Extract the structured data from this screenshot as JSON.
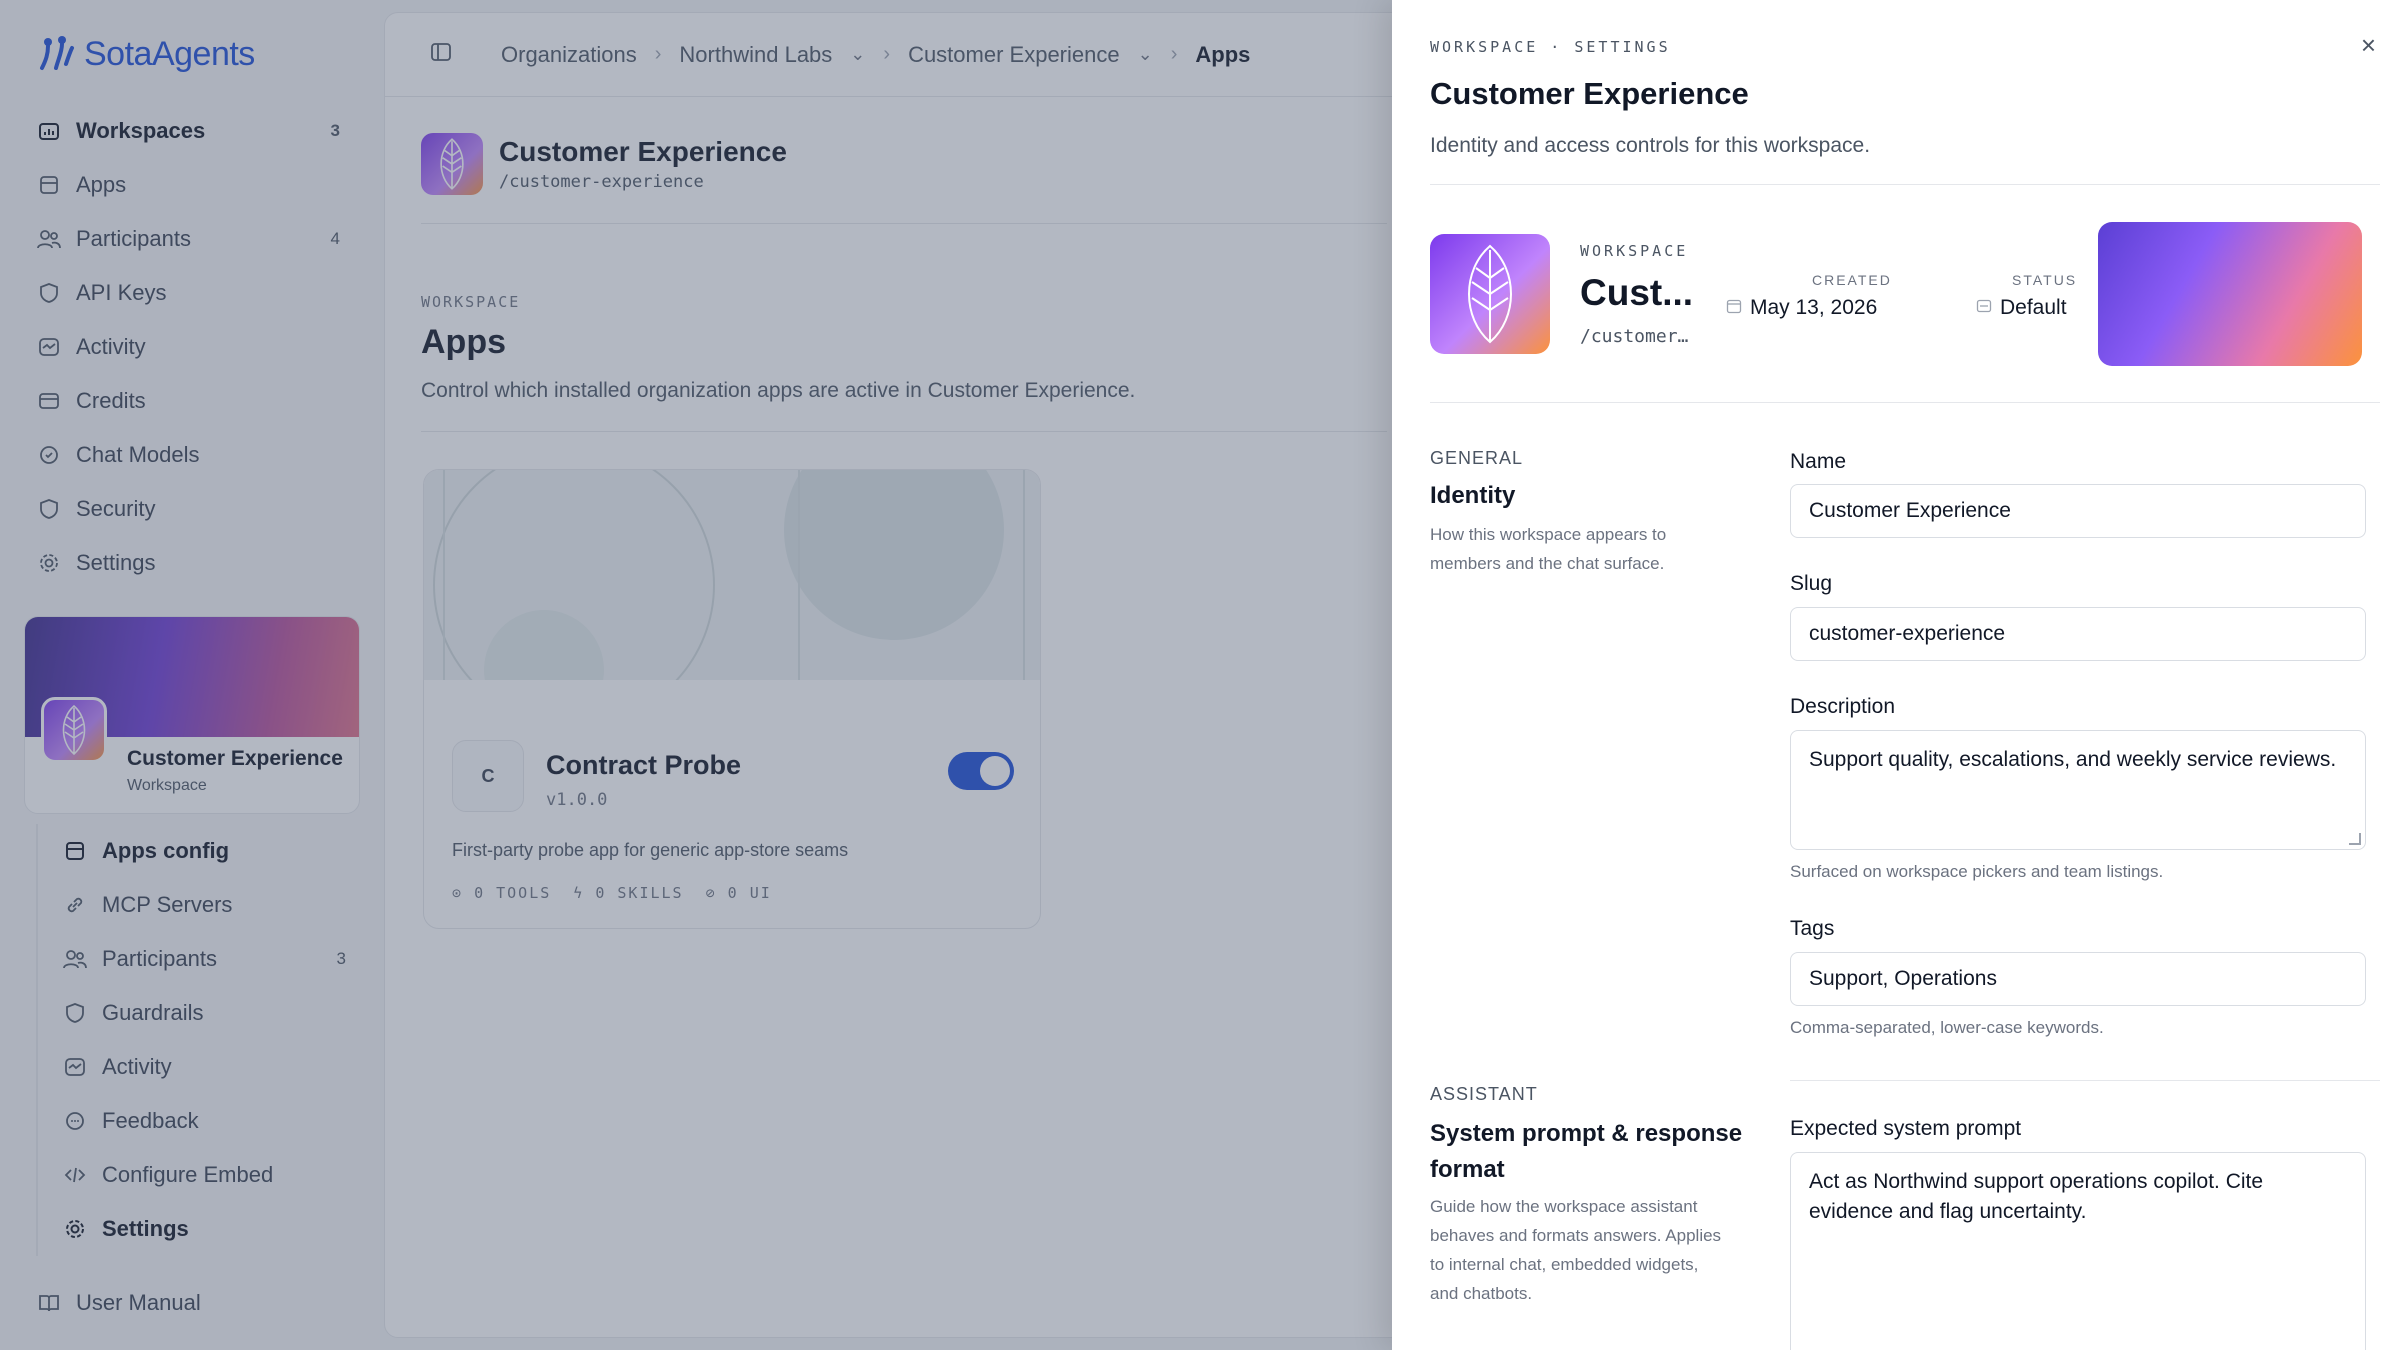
{
  "brand": {
    "name": "SotaAgents",
    "color": "#1d4ed8"
  },
  "sidebar": {
    "items": [
      {
        "label": "Workspaces",
        "count": "3",
        "icon": "workspaces-icon",
        "active": true
      },
      {
        "label": "Apps",
        "count": "",
        "icon": "apps-icon"
      },
      {
        "label": "Participants",
        "count": "4",
        "icon": "participants-icon"
      },
      {
        "label": "API Keys",
        "count": "",
        "icon": "shield-icon"
      },
      {
        "label": "Activity",
        "count": "",
        "icon": "activity-icon"
      },
      {
        "label": "Credits",
        "count": "",
        "icon": "credits-icon"
      },
      {
        "label": "Chat Models",
        "count": "",
        "icon": "chat-models-icon"
      },
      {
        "label": "Security",
        "count": "",
        "icon": "shield-icon"
      },
      {
        "label": "Settings",
        "count": "",
        "icon": "gear-icon"
      }
    ],
    "workspace_card": {
      "name": "Customer Experience",
      "type": "Workspace"
    },
    "subitems": [
      {
        "label": "Apps config",
        "count": "",
        "icon": "apps-icon",
        "active": true
      },
      {
        "label": "MCP Servers",
        "count": "",
        "icon": "link-icon"
      },
      {
        "label": "Participants",
        "count": "3",
        "icon": "participants-icon"
      },
      {
        "label": "Guardrails",
        "count": "",
        "icon": "shield-icon"
      },
      {
        "label": "Activity",
        "count": "",
        "icon": "activity-icon"
      },
      {
        "label": "Feedback",
        "count": "",
        "icon": "feedback-icon"
      },
      {
        "label": "Configure Embed",
        "count": "",
        "icon": "code-icon"
      },
      {
        "label": "Settings",
        "count": "",
        "icon": "gear-icon",
        "active": true
      }
    ],
    "footer": {
      "label": "User Manual",
      "icon": "book-icon"
    }
  },
  "breadcrumb": {
    "items": [
      "Organizations",
      "Northwind Labs",
      "Customer Experience",
      "Apps"
    ]
  },
  "main": {
    "workspace_title": "Customer Experience",
    "workspace_slug": "/customer-experience",
    "kicker": "WORKSPACE",
    "title": "Apps",
    "description": "Control which installed organization apps are active in Customer Experience.",
    "app": {
      "initial": "C",
      "name": "Contract Probe",
      "version": "v1.0.0",
      "enabled": true,
      "description": "First-party probe app for generic app-store seams",
      "stats": [
        "0 TOOLS",
        "0 SKILLS",
        "0 UI"
      ]
    }
  },
  "drawer": {
    "kicker": "WORKSPACE · SETTINGS",
    "title": "Customer Experience",
    "description": "Identity and access controls for this workspace.",
    "summary": {
      "kicker": "WORKSPACE",
      "name": "Cust...",
      "slug": "/customer...",
      "created_label": "CREATED",
      "created_value": "May 13, 2026",
      "status_label": "STATUS",
      "status_value": "Default"
    },
    "general": {
      "kicker": "GENERAL",
      "title": "Identity",
      "description": "How this workspace appears to members and the chat surface.",
      "name_label": "Name",
      "name_value": "Customer Experience",
      "slug_label": "Slug",
      "slug_value": "customer-experience",
      "description_label": "Description",
      "description_value": "Support quality, escalations, and weekly service reviews.",
      "description_help": "Surfaced on workspace pickers and team listings.",
      "tags_label": "Tags",
      "tags_value": "Support, Operations",
      "tags_help": "Comma-separated, lower-case keywords."
    },
    "assistant": {
      "kicker": "ASSISTANT",
      "title": "System prompt & response format",
      "description": "Guide how the workspace assistant behaves and formats answers. Applies to internal chat, embedded widgets, and chatbots.",
      "prompt_label": "Expected system prompt",
      "prompt_value": "Act as Northwind support operations copilot. Cite evidence and flag uncertainty."
    }
  }
}
